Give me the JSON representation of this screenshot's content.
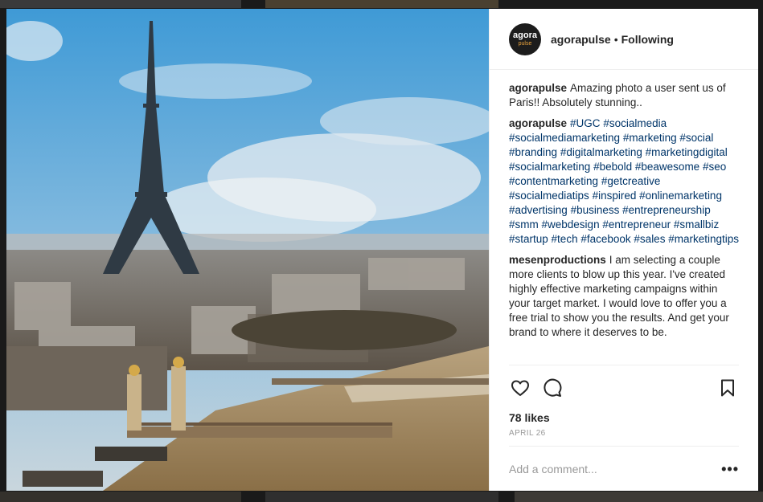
{
  "account": {
    "username": "agorapulse",
    "separator": "•",
    "follow_status": "Following",
    "avatar_line1": "agora",
    "avatar_line2": "pulse"
  },
  "comments": [
    {
      "user": "agorapulse",
      "text": "Amazing photo a user sent us of Paris!! Absolutely stunning.."
    },
    {
      "user": "agorapulse",
      "hashtags": [
        "#UGC",
        "#socialmedia",
        "#socialmediamarketing",
        "#marketing",
        "#social",
        "#branding",
        "#digitalmarketing",
        "#marketingdigital",
        "#socialmarketing",
        "#bebold",
        "#beawesome",
        "#seo",
        "#contentmarketing",
        "#getcreative",
        "#socialmediatips",
        "#inspired",
        "#onlinemarketing",
        "#advertising",
        "#business",
        "#entrepreneurship",
        "#smm",
        "#webdesign",
        "#entrepreneur",
        "#smallbiz",
        "#startup",
        "#tech",
        "#facebook",
        "#sales",
        "#marketingtips"
      ]
    },
    {
      "user": "mesenproductions",
      "text": "I am selecting a couple more clients to blow up this year. I've created highly effective marketing campaigns within your target market. I would love to offer you a free trial to show you the results. And get your brand to where it deserves to be."
    }
  ],
  "likes": "78 likes",
  "date": "APRIL 26",
  "add_comment": {
    "placeholder": "Add a comment...",
    "value": ""
  },
  "more_label": "•••",
  "icons": [
    "heart-icon",
    "comment-icon",
    "bookmark-icon",
    "more-options-icon"
  ],
  "colors": {
    "text": "#262626",
    "hashtag": "#003569",
    "muted": "#999999",
    "border": "#efefef"
  }
}
